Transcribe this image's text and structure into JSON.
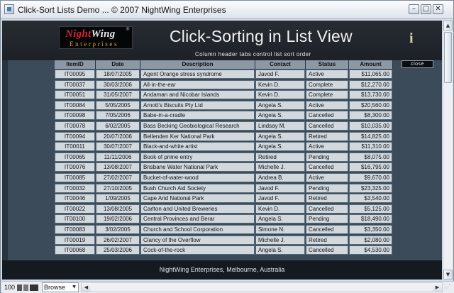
{
  "window": {
    "title": "Click-Sort Lists Demo  ...  © 2007 NightWing Enterprises",
    "min_glyph": "–",
    "max_glyph": "□",
    "close_glyph": "✕"
  },
  "header": {
    "logo_night": "Night",
    "logo_wing": "Wing",
    "logo_reg": "®",
    "logo_sub": "Enterprises",
    "title": "Click-Sorting in List View",
    "subtitle": "Column header tabs control list sort order",
    "info_glyph": "i"
  },
  "table": {
    "columns": [
      "ItemID",
      "Date",
      "Description",
      "Contact",
      "Status",
      "Amount"
    ],
    "close_label": "close",
    "rows": [
      [
        "IT00095",
        "18/07/2005",
        "Agent Orange stress syndrome",
        "Javod F.",
        "Active",
        "$11,065.00"
      ],
      [
        "IT00037",
        "30/03/2006",
        "All-in-the-ear",
        "Kevin D.",
        "Complete",
        "$12,270.00"
      ],
      [
        "IT00051",
        "31/05/2007",
        "Andaman and Nicobar Islands",
        "Kevin D.",
        "Complete",
        "$13,730.00"
      ],
      [
        "IT00084",
        "5/05/2005",
        "Arnott's Biscuits Pty Ltd",
        "Angela S.",
        "Active",
        "$20,560.00"
      ],
      [
        "IT00098",
        "7/05/2006",
        "Babe-in-a-cradle",
        "Angela S.",
        "Cancelled",
        "$8,300.00"
      ],
      [
        "IT00078",
        "6/02/2005",
        "Bass Becking Geobiological Research",
        "Lindsay M.",
        "Cancelled",
        "$10,035.00"
      ],
      [
        "IT00094",
        "20/07/2006",
        "Bellenden Ker National Park",
        "Angela S.",
        "Retired",
        "$14,825.00"
      ],
      [
        "IT00011",
        "30/07/2007",
        "Black-and-white artist",
        "Angela S.",
        "Active",
        "$11,310.00"
      ],
      [
        "IT00065",
        "11/11/2006",
        "Book of prime entry",
        "Retired",
        "Pending",
        "$8,075.00"
      ],
      [
        "IT00076",
        "13/08/2007",
        "Brisbane Water National Park",
        "Michelle J.",
        "Cancelled",
        "$16,795.00"
      ],
      [
        "IT00085",
        "27/02/2007",
        "Bucket-of-water-wood",
        "Andrea B.",
        "Active",
        "$9,670.00"
      ],
      [
        "IT00032",
        "27/10/2005",
        "Bush Church Aid Society",
        "Javod F.",
        "Pending",
        "$23,325.00"
      ],
      [
        "IT00046",
        "1/09/2005",
        "Cape Arid National Park",
        "Javod F.",
        "Retired",
        "$3,540.00"
      ],
      [
        "IT00022",
        "13/08/2005",
        "Carlton and United Breweries",
        "Kevin D.",
        "Cancelled",
        "$5,125.00"
      ],
      [
        "IT00100",
        "19/02/2006",
        "Central Provinces and Berar",
        "Angela S.",
        "Pending",
        "$18,490.00"
      ],
      [
        "IT00083",
        "3/02/2005",
        "Church and School Corporation",
        "Simone N.",
        "Cancelled",
        "$3,350.00"
      ],
      [
        "IT00019",
        "26/02/2007",
        "Clancy of the Overflow",
        "Michelle J.",
        "Retired",
        "$2,080.00"
      ],
      [
        "IT00068",
        "25/03/2006",
        "Cock-of-the-rock",
        "Angela S.",
        "Cancelled",
        "$4,530.00"
      ]
    ]
  },
  "footer": {
    "text": "NightWing Enterprises, Melbourne, Australia"
  },
  "statusbar": {
    "zoom": "100",
    "mode": "Browse"
  }
}
